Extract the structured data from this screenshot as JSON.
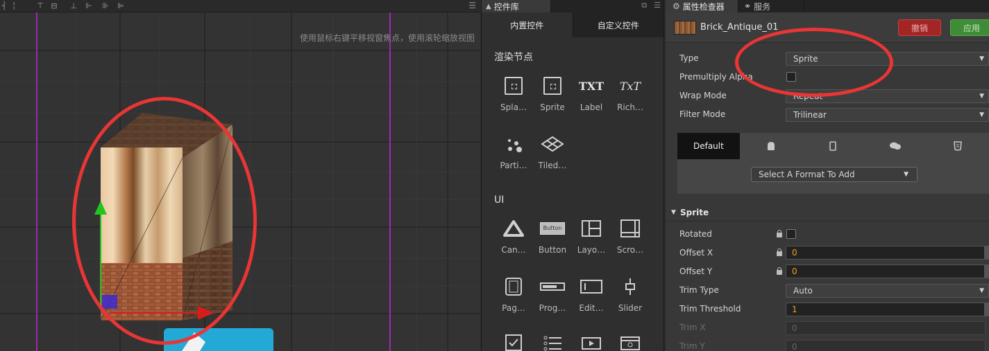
{
  "scene": {
    "hint": "使用鼠标右键平移视窗焦点，使用滚轮缩放视图",
    "toolbar_icons": [
      "align-left-icon",
      "align-center-h-icon",
      "align-right-icon",
      "align-top-icon",
      "align-center-v-icon",
      "align-bottom-icon",
      "distribute-h-icon",
      "distribute-v-icon",
      "distribute-center-icon"
    ]
  },
  "library": {
    "tab_label": "控件库",
    "subtabs": [
      "内置控件",
      "自定义控件"
    ],
    "sections": {
      "render": "渲染节点",
      "ui": "UI"
    },
    "render_items": [
      {
        "label": "Spla…",
        "icon": "splash-sprite-icon"
      },
      {
        "label": "Sprite",
        "icon": "sprite-icon"
      },
      {
        "label": "Label",
        "icon": "label-icon",
        "glyph": "TXT"
      },
      {
        "label": "Rich…",
        "icon": "richtext-icon",
        "glyph": "TxT"
      },
      {
        "label": "Parti…",
        "icon": "particle-icon"
      },
      {
        "label": "Tiled…",
        "icon": "tiledmap-icon"
      }
    ],
    "ui_items": [
      {
        "label": "Can…",
        "icon": "canvas-icon"
      },
      {
        "label": "Button",
        "icon": "button-icon",
        "glyph": "Button"
      },
      {
        "label": "Layo…",
        "icon": "layout-icon"
      },
      {
        "label": "Scro…",
        "icon": "scrollview-icon"
      },
      {
        "label": "Pag…",
        "icon": "pageview-icon"
      },
      {
        "label": "Prog…",
        "icon": "progressbar-icon"
      },
      {
        "label": "Edit…",
        "icon": "editbox-icon"
      },
      {
        "label": "Slider",
        "icon": "slider-icon"
      }
    ]
  },
  "inspector": {
    "tab_label": "属性检查器",
    "tab2_label": "服务",
    "node_name": "Brick_Antique_01",
    "revert_label": "撤销",
    "apply_label": "应用",
    "type_label": "Type",
    "type_value": "Sprite",
    "premultiply_label": "Premultiply Alpha",
    "wrap_label": "Wrap Mode",
    "wrap_value": "Repeat",
    "filter_label": "Filter Mode",
    "filter_value": "Trilinear",
    "platform_tabs": [
      "Default",
      "android-icon",
      "mobile-icon",
      "chat-icon",
      "html5-icon"
    ],
    "format_placeholder": "Select A Format To Add",
    "sprite_section": "Sprite",
    "rotated_label": "Rotated",
    "offset_x_label": "Offset X",
    "offset_x_value": "0",
    "offset_y_label": "Offset Y",
    "offset_y_value": "0",
    "trim_type_label": "Trim Type",
    "trim_type_value": "Auto",
    "trim_threshold_label": "Trim Threshold",
    "trim_threshold_value": "1",
    "trim_x_label": "Trim X",
    "trim_x_value": "0",
    "trim_y_label": "Trim Y",
    "trim_y_value": "0"
  },
  "colors": {
    "annotation": "#ea3535",
    "revert": "#a32626",
    "apply": "#3f8c36",
    "value_orange": "#f0a020"
  }
}
